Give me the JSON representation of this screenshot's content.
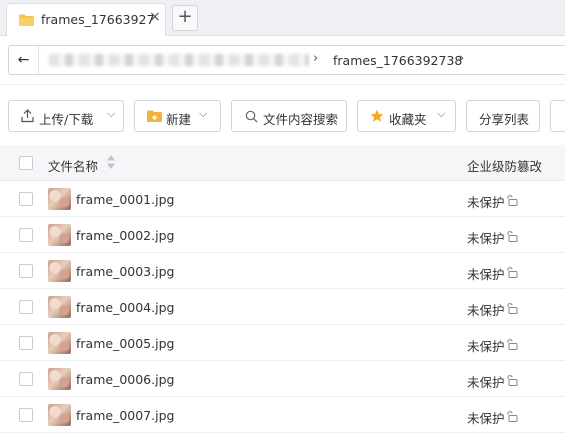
{
  "tab": {
    "title": "frames_17663927",
    "close_glyph": "×",
    "new_tab_glyph": "+"
  },
  "address": {
    "back_glyph": "←",
    "separator_glyph": "›",
    "current_folder": "frames_1766392738"
  },
  "toolbar": {
    "upload_download": "上传/下载",
    "new": "新建",
    "content_search": "文件内容搜索",
    "favorites": "收藏夹",
    "share_list": "分享列表",
    "caret_glyph": "⌵"
  },
  "table": {
    "col_name": "文件名称",
    "col_protection": "企业级防篡改"
  },
  "rows": [
    {
      "name": "frame_0001.jpg",
      "status": "未保护"
    },
    {
      "name": "frame_0002.jpg",
      "status": "未保护"
    },
    {
      "name": "frame_0003.jpg",
      "status": "未保护"
    },
    {
      "name": "frame_0004.jpg",
      "status": "未保护"
    },
    {
      "name": "frame_0005.jpg",
      "status": "未保护"
    },
    {
      "name": "frame_0006.jpg",
      "status": "未保护"
    },
    {
      "name": "frame_0007.jpg",
      "status": "未保护"
    }
  ],
  "icons": {
    "tab": "folder-icon",
    "upload": "upload-icon",
    "new": "new-folder-icon",
    "search": "search-icon",
    "favorites": "star-icon",
    "lock": "unlock-icon"
  },
  "colors": {
    "folder": "#f5c34a",
    "new_folder": "#f2b33d",
    "star": "#f5a623"
  }
}
